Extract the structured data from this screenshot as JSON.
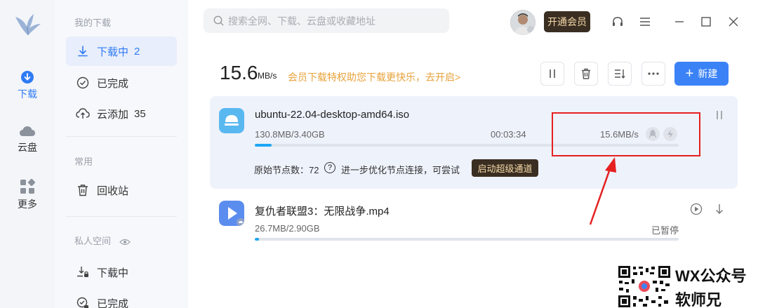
{
  "sidebar": {
    "rail": [
      {
        "label": "下载",
        "icon": "download-circle-icon",
        "active": true
      },
      {
        "label": "云盘",
        "icon": "cloud-icon",
        "active": false
      },
      {
        "label": "更多",
        "icon": "grid-more-icon",
        "active": false
      }
    ],
    "my_downloads_header": "我的下载",
    "items": [
      {
        "label": "下载中",
        "count": "2",
        "icon": "download-icon",
        "active": true
      },
      {
        "label": "已完成",
        "count": "",
        "icon": "check-circle-icon",
        "active": false
      },
      {
        "label": "云添加",
        "count": "35",
        "icon": "cloud-upload-icon",
        "active": false
      }
    ],
    "common_header": "常用",
    "recycle_label": "回收站",
    "private_header": "私人空间",
    "private_items": [
      {
        "label": "下载中",
        "icon": "download-lock-icon"
      },
      {
        "label": "已完成",
        "icon": "check-lock-icon"
      }
    ]
  },
  "topbar": {
    "search_placeholder": "搜索全网、下载、云盘或收藏地址",
    "vip_label": "开通会员",
    "icons": [
      "headset-icon",
      "menu-icon",
      "minimize-icon",
      "maximize-icon",
      "close-icon"
    ]
  },
  "header": {
    "speed": "15.6",
    "speed_unit": "MB/s",
    "promo": "会员下载特权助您下载更快乐，去开启>",
    "new_label": "新建"
  },
  "tasks": [
    {
      "name": "ubuntu-22.04-desktop-amd64.iso",
      "size": "130.8MB/3.40GB",
      "time": "00:03:34",
      "speed": "15.6MB/s",
      "progress": 0.04,
      "nodes": "原始节点数：72",
      "hint": "进一步优化节点连接，可尝试",
      "super_label": "启动超级通道",
      "icon_color": "#5ab8f0"
    },
    {
      "name": "复仇者联盟3：无限战争.mp4",
      "size": "26.7MB/2.90GB",
      "status": "已暂停",
      "progress": 0.01,
      "icon_color": "#5b8def"
    }
  ],
  "watermark": {
    "line1": "WX公众号",
    "line2": "软师兄"
  }
}
